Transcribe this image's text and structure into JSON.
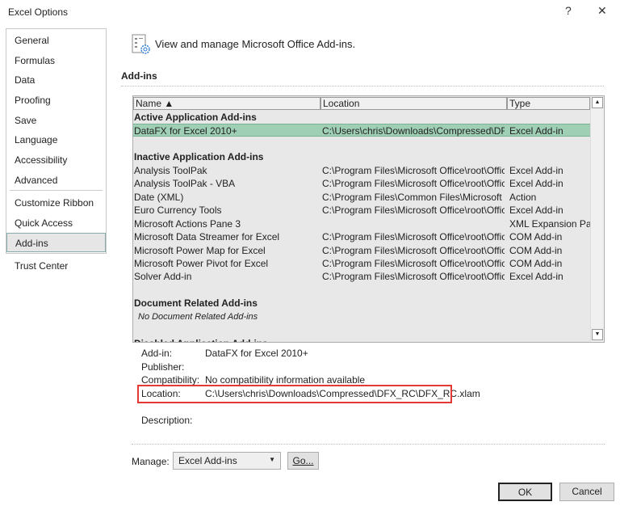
{
  "window": {
    "title": "Excel Options",
    "help": "?",
    "close": "✕"
  },
  "nav": {
    "items": [
      "General",
      "Formulas",
      "Data",
      "Proofing",
      "Save",
      "Language",
      "Accessibility",
      "Advanced",
      "Customize Ribbon",
      "Quick Access Toolbar",
      "Add-ins",
      "Trust Center"
    ],
    "selected": "Add-ins"
  },
  "main": {
    "heading": "View and manage Microsoft Office Add-ins.",
    "section": "Add-ins"
  },
  "list": {
    "columns": [
      "Name ▲",
      "Location",
      "Type"
    ],
    "rows": [
      {
        "kind": "group",
        "name": "Active Application Add-ins"
      },
      {
        "kind": "item",
        "name": "DataFX for Excel 2010+",
        "location": "C:\\Users\\chris\\Downloads\\Compressed\\DFX_",
        "type": "Excel Add-in",
        "selected": true
      },
      {
        "kind": "blank"
      },
      {
        "kind": "group",
        "name": "Inactive Application Add-ins"
      },
      {
        "kind": "item",
        "name": "Analysis ToolPak",
        "location": "C:\\Program Files\\Microsoft Office\\root\\Offic",
        "type": "Excel Add-in"
      },
      {
        "kind": "item",
        "name": "Analysis ToolPak - VBA",
        "location": "C:\\Program Files\\Microsoft Office\\root\\Offic",
        "type": "Excel Add-in"
      },
      {
        "kind": "item",
        "name": "Date (XML)",
        "location": "C:\\Program Files\\Common Files\\Microsoft S",
        "type": "Action"
      },
      {
        "kind": "item",
        "name": "Euro Currency Tools",
        "location": "C:\\Program Files\\Microsoft Office\\root\\Offic",
        "type": "Excel Add-in"
      },
      {
        "kind": "item",
        "name": "Microsoft Actions Pane 3",
        "location": "",
        "type": "XML Expansion Pack"
      },
      {
        "kind": "item",
        "name": "Microsoft Data Streamer for Excel",
        "location": "C:\\Program Files\\Microsoft Office\\root\\Offic",
        "type": "COM Add-in"
      },
      {
        "kind": "item",
        "name": "Microsoft Power Map for Excel",
        "location": "C:\\Program Files\\Microsoft Office\\root\\Offic",
        "type": "COM Add-in"
      },
      {
        "kind": "item",
        "name": "Microsoft Power Pivot for Excel",
        "location": "C:\\Program Files\\Microsoft Office\\root\\Offic",
        "type": "COM Add-in"
      },
      {
        "kind": "item",
        "name": "Solver Add-in",
        "location": "C:\\Program Files\\Microsoft Office\\root\\Offic",
        "type": "Excel Add-in"
      },
      {
        "kind": "blank"
      },
      {
        "kind": "group",
        "name": "Document Related Add-ins"
      },
      {
        "kind": "note",
        "name": "No Document Related Add-ins"
      },
      {
        "kind": "blank"
      },
      {
        "kind": "group",
        "name": "Disabled Application Add-ins"
      }
    ]
  },
  "details": {
    "addin_label": "Add-in:",
    "addin": "DataFX for Excel 2010+",
    "publisher_label": "Publisher:",
    "publisher": "",
    "compat_label": "Compatibility:",
    "compat": "No compatibility information available",
    "location_label": "Location:",
    "location": "C:\\Users\\chris\\Downloads\\Compressed\\DFX_RC\\DFX_RC.xlam",
    "description_label": "Description:",
    "description": ""
  },
  "manage": {
    "label": "Manage:",
    "value": "Excel Add-ins",
    "go": "Go..."
  },
  "footer": {
    "ok": "OK",
    "cancel": "Cancel"
  },
  "colors": {
    "selected_row": "#9fcfb4",
    "highlight_box": "#e53935"
  }
}
